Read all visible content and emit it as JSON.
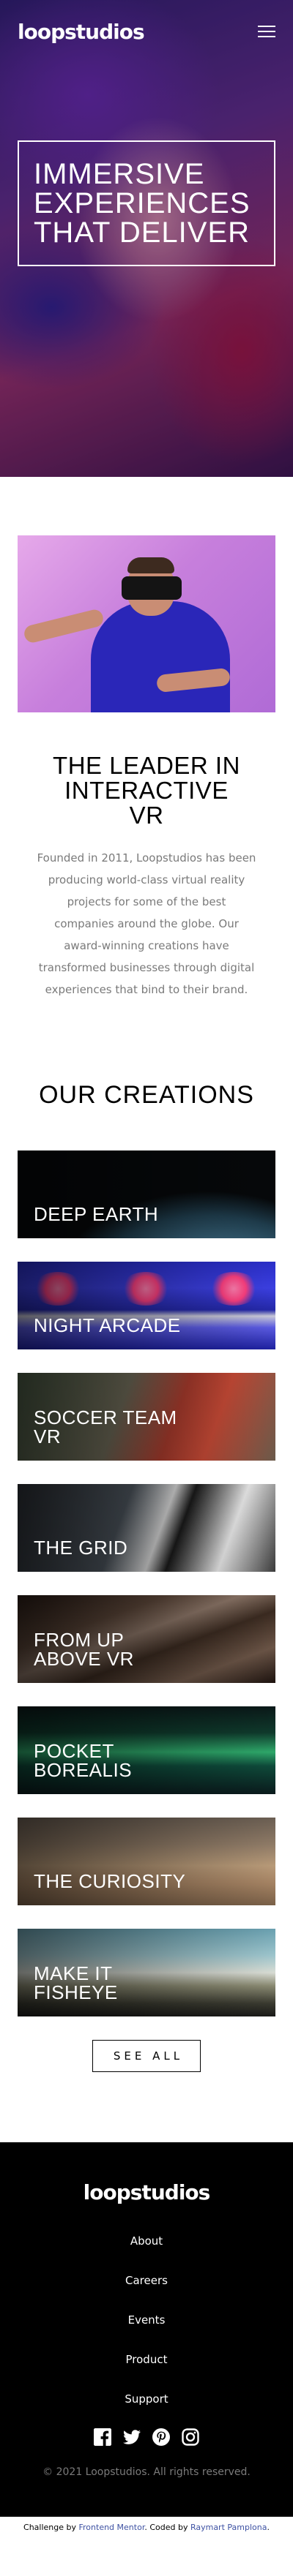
{
  "header": {
    "logo": "loopstudios",
    "menu_icon": "hamburger-menu-icon"
  },
  "hero": {
    "lines": [
      "Immersive",
      "experiences",
      "that deliver"
    ]
  },
  "interactive": {
    "image_alt": "man using VR headset",
    "title_lines": [
      "The leader in",
      "interactive",
      "VR"
    ],
    "text_lines": [
      "Founded in 2011, Loopstudios has been",
      "producing world-class virtual reality",
      "projects for some of the best",
      "companies around the globe. Our",
      "award-winning creations have",
      "transformed businesses through digital",
      "experiences that bind to their brand."
    ]
  },
  "creations": {
    "title": "Our creations",
    "items": [
      {
        "lines": [
          "Deep earth"
        ]
      },
      {
        "lines": [
          "Night arcade"
        ]
      },
      {
        "lines": [
          "Soccer team",
          "VR"
        ]
      },
      {
        "lines": [
          "The grid"
        ]
      },
      {
        "lines": [
          "From up",
          "above VR"
        ]
      },
      {
        "lines": [
          "Pocket",
          "borealis"
        ]
      },
      {
        "lines": [
          "The curiosity"
        ]
      },
      {
        "lines": [
          "Make it",
          "fisheye"
        ]
      }
    ],
    "see_all": "See all"
  },
  "footer": {
    "logo": "loopstudios",
    "nav": [
      "About",
      "Careers",
      "Events",
      "Product",
      "Support"
    ],
    "socials": [
      "facebook-icon",
      "twitter-icon",
      "pinterest-icon",
      "instagram-icon"
    ],
    "copyright": "© 2021 Loopstudios. All rights reserved."
  },
  "attribution": {
    "prefix": "Challenge by",
    "fm": "Frontend Mentor",
    "middle": ". Coded by",
    "author": "Raymart Pamplona",
    "suffix": "."
  },
  "colors": {
    "accent_link": "#3e52a3",
    "muted_text": "#7a7a7a"
  }
}
